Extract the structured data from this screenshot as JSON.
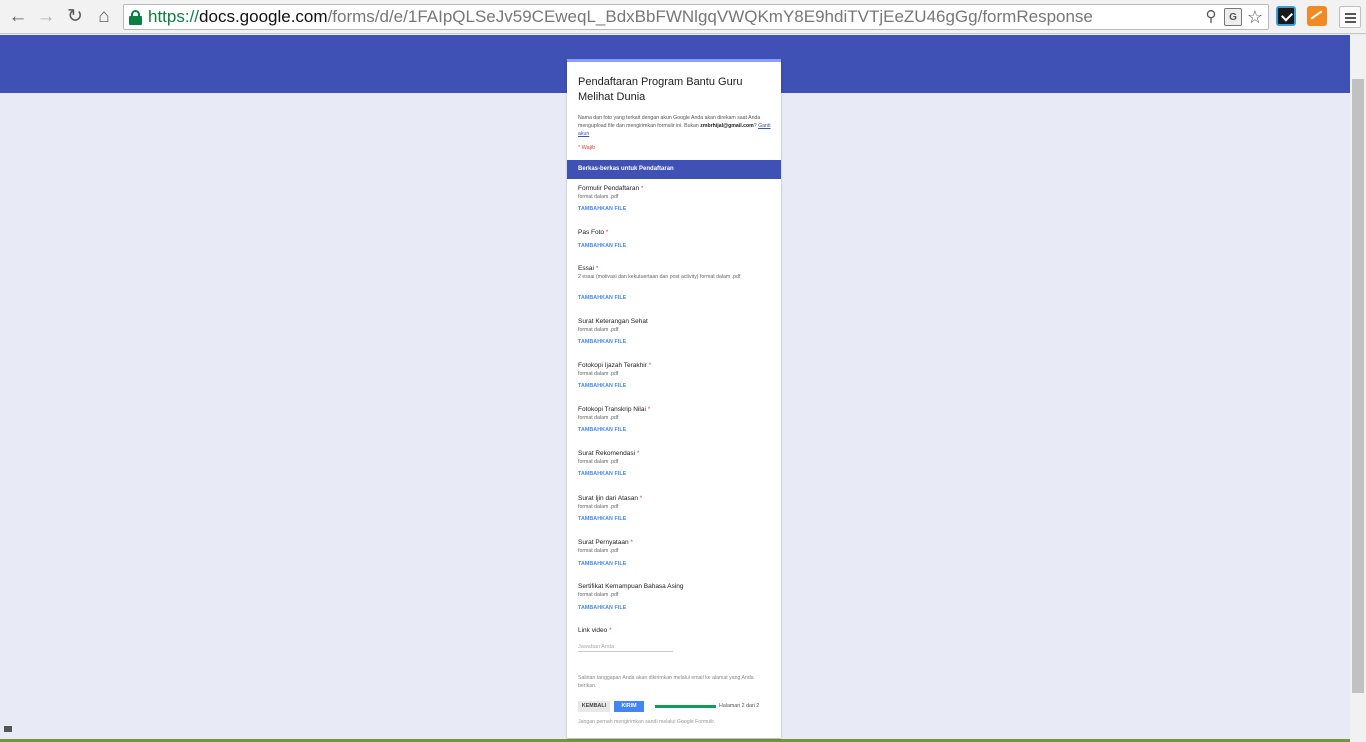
{
  "browser": {
    "url_scheme": "https://",
    "url_host": "docs.google.com",
    "url_path": "/forms/d/e/1FAIpQLSeJv59CEweqL_BdxBbFWNlgqVWQKmY8E9hdiTVTjEeZU46gGg/formResponse",
    "icons": [
      "back-arrow-icon",
      "forward-arrow-icon",
      "reload-icon",
      "home-icon",
      "lock-icon",
      "zoom-icon",
      "translate-icon",
      "star-icon",
      "extension-check-icon",
      "extension-chart-icon",
      "menu-icon"
    ]
  },
  "colors": {
    "banner": "#3f51b5",
    "page_background": "#e8eaf6",
    "section_header": "#3f51b5",
    "accent_link": "#4285f4",
    "required": "#db4437",
    "progress": "#0f9d58"
  },
  "form": {
    "title": "Pendaftaran Program Bantu Guru Melihat Dunia",
    "description_before": "Nama dan foto yang terkait dengan akun Google Anda akan direkam saat Anda mengupload file dan mengirimkan formulir ini. Bukan",
    "account_email": "zmbrhijal@gmail.com",
    "description_after": "?",
    "switch_account": "Ganti akun",
    "required_note": "* Wajib",
    "section_title": "Berkas-berkas untuk Pendaftaran",
    "add_file_label": "TAMBAHKAN FILE",
    "questions": [
      {
        "title": "Formulir Pendaftaran",
        "required": "*",
        "description": "format dalam .pdf"
      },
      {
        "title": "Pas Foto",
        "required": "*",
        "description": ""
      },
      {
        "title": "Essai",
        "required": "*",
        "description": "2 essai (motivasi dan kekutuertaan dan post activity) format dalam .pdf"
      },
      {
        "title": "Surat Keterangan Sehat",
        "required": "",
        "description": "format dalam .pdf"
      },
      {
        "title": "Fotokopi Ijazah Terakhir",
        "required": "*",
        "description": "format dalam .pdf"
      },
      {
        "title": "Fotokopi Transkrip Nilai",
        "required": "*",
        "description": "format dalam .pdf"
      },
      {
        "title": "Surat Rekomendasi",
        "required": "*",
        "description": "format dalam .pdf"
      },
      {
        "title": "Surat Ijin dari Atasan",
        "required": "*",
        "description": "format dalam .pdf"
      },
      {
        "title": "Surat Pernyataan",
        "required": "*",
        "description": "format dalam .pdf"
      },
      {
        "title": "Sertifikat Kemampuan Bahasa Asing",
        "required": "",
        "description": "format dalam .pdf"
      }
    ],
    "link_video": {
      "title": "Link video",
      "required": "*",
      "placeholder": "Jawaban Anda"
    },
    "email_note": "Salinan tanggapan Anda akan dikirimkan melalui email ke alamat yang Anda berikan.",
    "back_button": "KEMBALI",
    "submit_button": "KIRIM",
    "progress": 1.0,
    "page_indicator": "Halaman 2 dari 2",
    "footer_note": "Jangan pernah mengirimkan sandi melalui Google Formulir."
  }
}
